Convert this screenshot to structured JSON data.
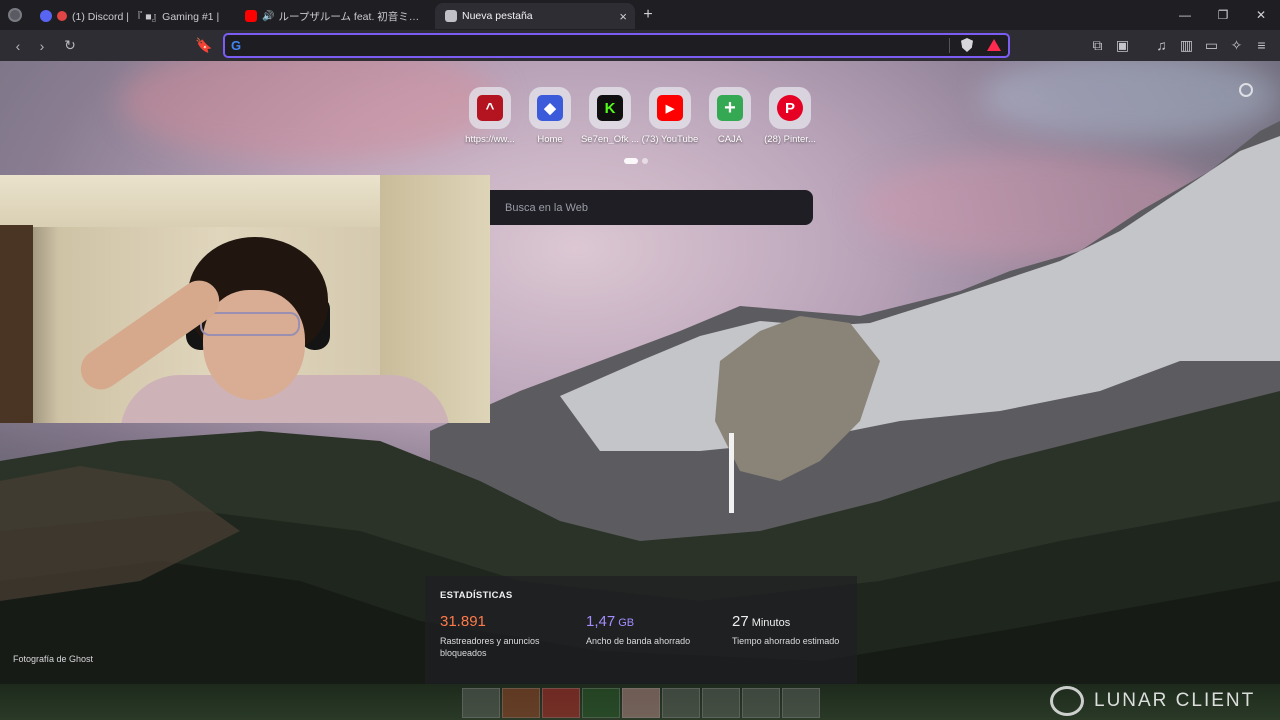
{
  "tabs": [
    {
      "title": "(1) Discord | 『 ■』Gaming #1 |",
      "favicon_color": "#5865f2",
      "active": false
    },
    {
      "title": "ループザルーム feat. 初音ミク / \"Loop",
      "favicon_color": "#ff0000",
      "active": false
    },
    {
      "title": "Nueva pestaña",
      "favicon_color": "#c0c0c6",
      "active": true
    }
  ],
  "toolbar": {
    "address_value": "",
    "google_letter": "G"
  },
  "shortcuts": [
    {
      "label": "https://ww...",
      "icon": "red-logo-icon",
      "color": "#b3141f",
      "glyph": "^"
    },
    {
      "label": "Home",
      "icon": "roblox-icon",
      "color": "#3b5bdb",
      "glyph": "◆"
    },
    {
      "label": "Se7en_Ofk ...",
      "icon": "k-logo-icon",
      "color": "#0f0f0f",
      "glyph": "K"
    },
    {
      "label": "(73) YouTube",
      "icon": "youtube-icon",
      "color": "#ff0000",
      "glyph": "▶"
    },
    {
      "label": "CAJA",
      "icon": "plus-icon",
      "color": "#34a853",
      "glyph": "+"
    },
    {
      "label": "(28) Pinter...",
      "icon": "pinterest-icon",
      "color": "#e60023",
      "glyph": "P"
    }
  ],
  "search": {
    "placeholder": "Busca en la Web"
  },
  "credit": "Fotografía de Ghost",
  "stats": {
    "title": "ESTADÍSTICAS",
    "items": [
      {
        "value": "31.891",
        "unit": "",
        "label": "Rastreadores y anuncios bloqueados",
        "color": "#ff7a4a"
      },
      {
        "value": "1,47",
        "unit": "GB",
        "label": "Ancho de banda ahorrado",
        "color": "#a58cff"
      },
      {
        "value": "27",
        "unit": "Minutos",
        "label": "Tiempo ahorrado estimado",
        "color": "#ffffff"
      }
    ]
  },
  "overlay": {
    "brand": "LUNAR CLIENT"
  }
}
